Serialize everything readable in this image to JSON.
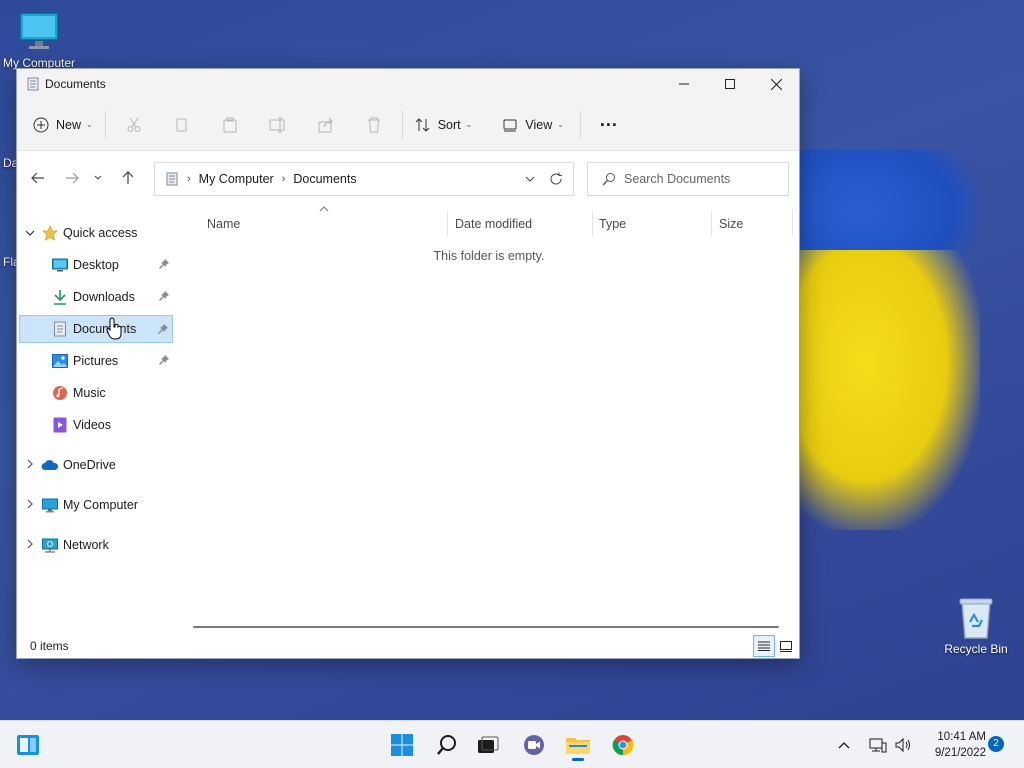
{
  "desktop": {
    "icons": {
      "my_computer": "My Computer",
      "recycle_bin": "Recycle Bin"
    },
    "fragments": [
      "Da",
      "Fla"
    ]
  },
  "window": {
    "title": "Documents",
    "controls": [
      "minimize",
      "maximize",
      "close"
    ]
  },
  "toolbar": {
    "new_label": "New",
    "sort_label": "Sort",
    "view_label": "View",
    "more_label": "..."
  },
  "address": {
    "breadcrumbs": [
      "My Computer",
      "Documents"
    ]
  },
  "search": {
    "placeholder": "Search Documents"
  },
  "navpane": {
    "quick_access": "Quick access",
    "items": [
      {
        "label": "Desktop",
        "pinned": true
      },
      {
        "label": "Downloads",
        "pinned": true
      },
      {
        "label": "Documents",
        "pinned": true,
        "selected": true
      },
      {
        "label": "Pictures",
        "pinned": true
      },
      {
        "label": "Music",
        "pinned": false
      },
      {
        "label": "Videos",
        "pinned": false
      }
    ],
    "roots": [
      "OneDrive",
      "My Computer",
      "Network"
    ]
  },
  "content": {
    "columns": [
      "Name",
      "Date modified",
      "Type",
      "Size"
    ],
    "empty_message": "This folder is empty."
  },
  "statusbar": {
    "item_count": "0 items"
  },
  "taskbar": {
    "time": "10:41 AM",
    "date": "9/21/2022",
    "notification_count": "2"
  },
  "colors": {
    "accent": "#0067c0",
    "selection": "#cce4f7",
    "folder": "#f3c24c"
  }
}
